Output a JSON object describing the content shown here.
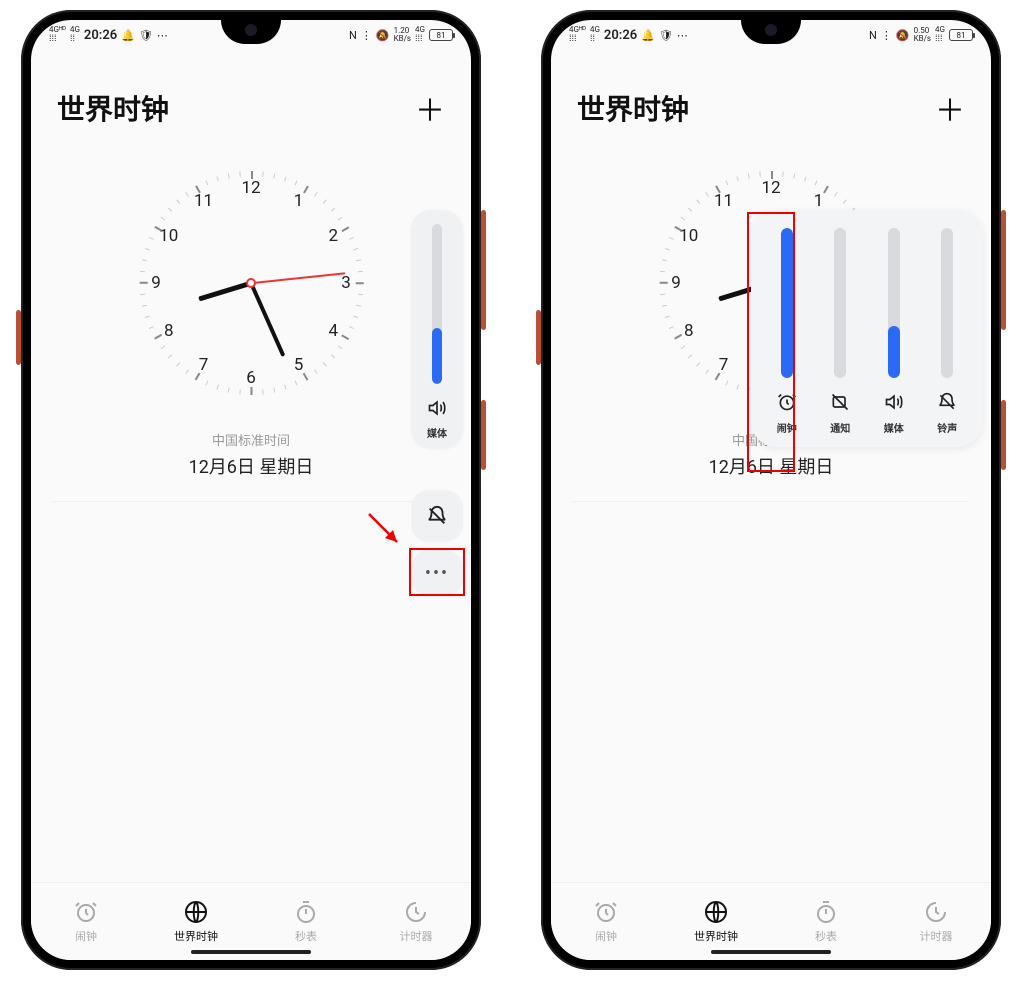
{
  "status": {
    "net1": "4Gᴴᴰ",
    "net2": "4G",
    "time": "20:26",
    "nfc": "N",
    "bt": "ᵇ",
    "mute": "⊘",
    "rate1": "1.20",
    "rate2": "0.50",
    "rate_unit": "KB/s",
    "sig": "4G",
    "battery": "81"
  },
  "header": {
    "title": "世界时钟",
    "add": "＋"
  },
  "clock": {
    "timezone": "中国标准时间",
    "date": "12月6日 星期日"
  },
  "vol_single": {
    "fill_pct": 35,
    "label": "媒体"
  },
  "vol_expanded": {
    "cols": [
      {
        "key": "alarm",
        "label": "闹钟",
        "fill": 100
      },
      {
        "key": "notify",
        "label": "通知",
        "fill": 0
      },
      {
        "key": "media",
        "label": "媒体",
        "fill": 35
      },
      {
        "key": "ring",
        "label": "铃声",
        "fill": 0
      }
    ]
  },
  "nav": {
    "items": [
      {
        "key": "alarm",
        "label": "闹钟"
      },
      {
        "key": "world",
        "label": "世界时钟"
      },
      {
        "key": "stopwatch",
        "label": "秒表"
      },
      {
        "key": "timer",
        "label": "计时器"
      }
    ]
  }
}
